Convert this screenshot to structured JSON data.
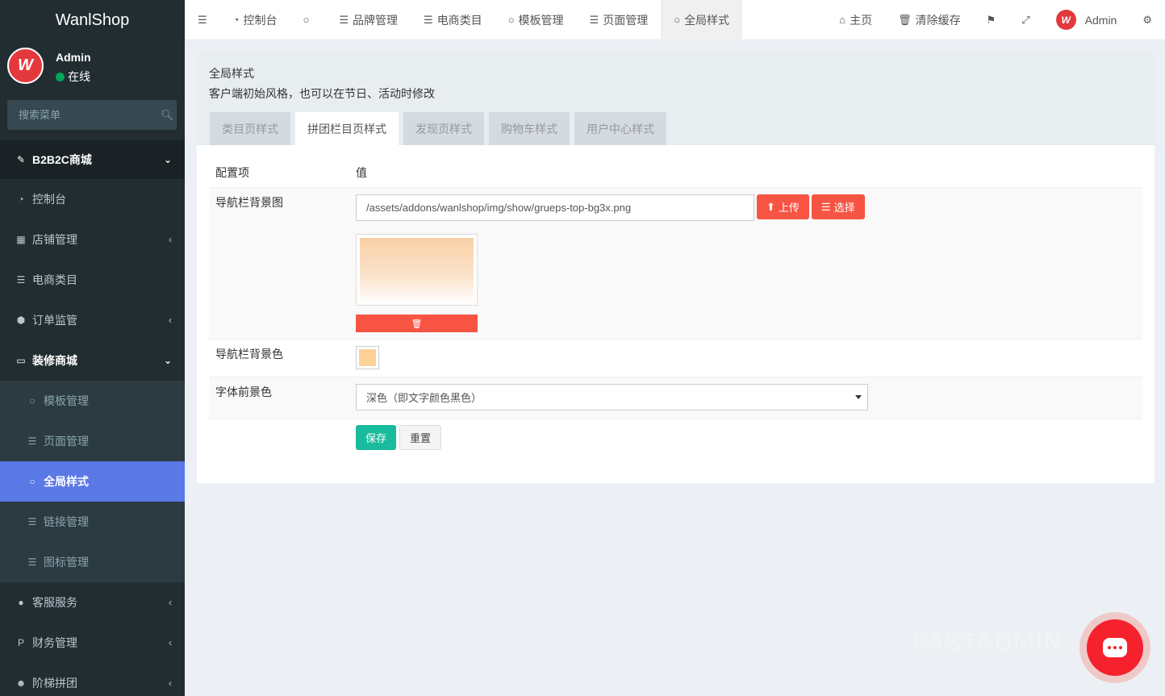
{
  "app": {
    "logo": "WanlShop"
  },
  "user": {
    "name": "Admin",
    "status": "在线"
  },
  "sidebar": {
    "search_placeholder": "搜索菜单",
    "items": [
      {
        "label": "B2B2C商城",
        "icon": "magic-icon"
      },
      {
        "label": "控制台",
        "icon": "dashboard-icon"
      },
      {
        "label": "店铺管理",
        "icon": "store-icon"
      },
      {
        "label": "电商类目",
        "icon": "list-ol-icon"
      },
      {
        "label": "订单监管",
        "icon": "cube-icon"
      },
      {
        "label": "装修商城",
        "icon": "desktop-icon"
      },
      {
        "label": "模板管理",
        "icon": "circle-icon"
      },
      {
        "label": "页面管理",
        "icon": "list-icon"
      },
      {
        "label": "全局样式",
        "icon": "circle-icon"
      },
      {
        "label": "链接管理",
        "icon": "list-icon"
      },
      {
        "label": "图标管理",
        "icon": "list-icon"
      },
      {
        "label": "客服服务",
        "icon": "comments-icon"
      },
      {
        "label": "财务管理",
        "icon": "paypal-icon"
      },
      {
        "label": "阶梯拼团",
        "icon": "users-icon"
      }
    ]
  },
  "topbar": {
    "tabs": [
      {
        "label": "控制台"
      },
      {
        "label": ""
      },
      {
        "label": "品牌管理"
      },
      {
        "label": "电商类目"
      },
      {
        "label": "模板管理"
      },
      {
        "label": "页面管理"
      },
      {
        "label": "全局样式"
      }
    ],
    "home": "主页",
    "clear_cache": "清除缓存",
    "admin": "Admin"
  },
  "panel": {
    "title": "全局样式",
    "desc": "客户端初始风格，也可以在节日、活动时修改",
    "tabs": [
      "类目页样式",
      "拼团栏目页样式",
      "发现页样式",
      "购物车样式",
      "用户中心样式"
    ]
  },
  "table": {
    "col_key": "配置项",
    "col_val": "值",
    "rows": {
      "bg_image_label": "导航栏背景图",
      "bg_image_value": "/assets/addons/wanlshop/img/show/grueps-top-bg3x.png",
      "upload_btn": "上传",
      "select_btn": "选择",
      "bg_color_label": "导航栏背景色",
      "bg_color_value": "#fdd197",
      "font_color_label": "字体前景色",
      "font_color_value": "深色（即文字颜色黑色）"
    },
    "save_btn": "保存",
    "reset_btn": "重置"
  },
  "watermark": "FASTADMIN"
}
